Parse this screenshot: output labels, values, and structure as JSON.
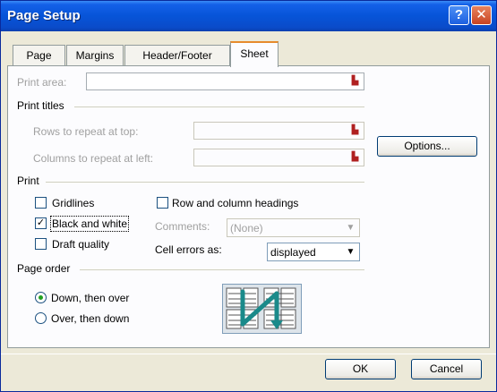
{
  "window": {
    "title": "Page Setup"
  },
  "titlebar": {
    "help_glyph": "?",
    "close_glyph": "✕"
  },
  "tabs": [
    {
      "label": "Page",
      "active": false
    },
    {
      "label": "Margins",
      "active": false
    },
    {
      "label": "Header/Footer",
      "active": false
    },
    {
      "label": "Sheet",
      "active": true
    }
  ],
  "print_area": {
    "label": "Print area:",
    "value": ""
  },
  "print_titles": {
    "heading": "Print titles",
    "rows_label": "Rows to repeat at top:",
    "rows_value": "",
    "cols_label": "Columns to repeat at left:",
    "cols_value": ""
  },
  "options_button": "Options...",
  "print": {
    "heading": "Print",
    "gridlines": {
      "label": "Gridlines",
      "checked": false
    },
    "black_and_white": {
      "label": "Black and white",
      "checked": true
    },
    "draft_quality": {
      "label": "Draft quality",
      "checked": false
    },
    "row_col_headings": {
      "label": "Row and column headings",
      "checked": false
    },
    "comments_label": "Comments:",
    "comments_value": "(None)",
    "cell_errors_label": "Cell errors as:",
    "cell_errors_value": "displayed"
  },
  "page_order": {
    "heading": "Page order",
    "down_then_over": {
      "label": "Down, then over",
      "selected": true
    },
    "over_then_down": {
      "label": "Over, then down",
      "selected": false
    }
  },
  "footer": {
    "ok": "OK",
    "cancel": "Cancel"
  },
  "colors": {
    "title_bar": "#0754d8",
    "tab_highlight": "#e68b2c",
    "radio_dot": "#21a121",
    "order_arrow": "#1a8a8a"
  }
}
